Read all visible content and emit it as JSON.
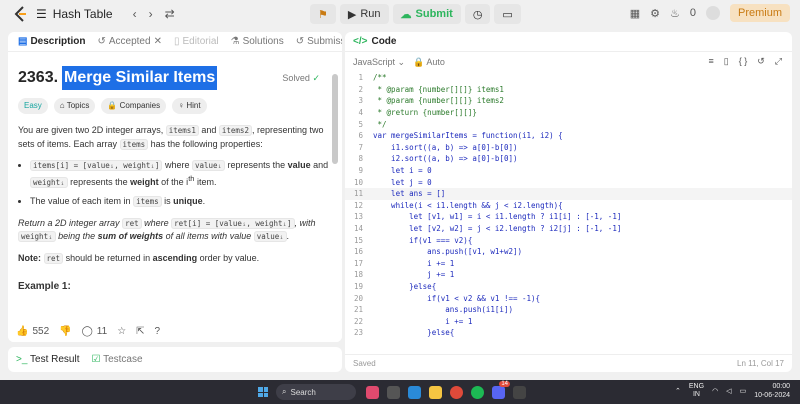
{
  "topbar": {
    "title": "Hash Table",
    "run_label": "Run",
    "submit_label": "Submit",
    "streak": "0",
    "premium_label": "Premium"
  },
  "left_tabs": [
    {
      "label": "Description"
    },
    {
      "label": "Accepted"
    },
    {
      "label": "Editorial"
    },
    {
      "label": "Solutions"
    },
    {
      "label": "Submiss"
    }
  ],
  "problem": {
    "number": "2363.",
    "title": "Merge Similar Items",
    "solved": "Solved",
    "difficulty": "Easy",
    "topics": "Topics",
    "companies": "Companies",
    "hint": "Hint",
    "p1a": "You are given two 2D integer arrays, ",
    "p1_items1": "items1",
    "p1b": " and ",
    "p1_items2": "items2",
    "p1c": ", representing two sets of items. Each array ",
    "p1_items": "items",
    "p1d": " has the following properties:",
    "b1_code": "items[i] = [valueᵢ, weightᵢ]",
    "b1a": " where ",
    "b1_value": "valueᵢ",
    "b1b": " represents the ",
    "b1_value_bold": "value",
    "b1c": " and ",
    "b1_weight": "weightᵢ",
    "b1d": " represents the ",
    "b1_weight_bold": "weight",
    "b1e": " of the i",
    "b1_th": "th",
    "b1f": " item.",
    "b2a": "The value of each item in ",
    "b2_code": "items",
    "b2b": " is ",
    "b2_bold": "unique",
    "b2c": ".",
    "r1": "Return a 2D integer array ",
    "r_code1": "ret",
    "r2": " where ",
    "r_code2": "ret[i] = [valueᵢ, weightᵢ]",
    "r3": ", with ",
    "r_code3": "weightᵢ",
    "r4": " being the ",
    "r_bold": "sum of weights",
    "r5": " of all items with value ",
    "r_code4": "valueᵢ",
    "r6": ".",
    "note_label": "Note:",
    "note_code": "ret",
    "note_a": " should be returned in ",
    "note_bold": "ascending",
    "note_b": " order by value.",
    "example": "Example 1:"
  },
  "actions": {
    "likes": "552",
    "comments": "11"
  },
  "bottom": {
    "test_result": "Test Result",
    "testcase": "Testcase"
  },
  "code_panel": {
    "title": "Code",
    "language": "JavaScript",
    "mode": "Auto",
    "saved": "Saved",
    "position": "Ln 11, Col 17"
  },
  "code_lines": [
    {
      "n": "1",
      "t": "/**"
    },
    {
      "n": "2",
      "t": " * @param {number[][]} items1"
    },
    {
      "n": "3",
      "t": " * @param {number[][]} items2"
    },
    {
      "n": "4",
      "t": " * @return {number[][]}"
    },
    {
      "n": "5",
      "t": " */"
    },
    {
      "n": "6",
      "t": "var mergeSimilarItems = function(i1, i2) {"
    },
    {
      "n": "7",
      "t": "    i1.sort((a, b) => a[0]-b[0])"
    },
    {
      "n": "8",
      "t": "    i2.sort((a, b) => a[0]-b[0])"
    },
    {
      "n": "9",
      "t": "    let i = 0"
    },
    {
      "n": "10",
      "t": "    let j = 0"
    },
    {
      "n": "11",
      "t": "    let ans = []"
    },
    {
      "n": "12",
      "t": "    while(i < i1.length && j < i2.length){"
    },
    {
      "n": "13",
      "t": "        let [v1, w1] = i < i1.length ? i1[i] : [-1, -1]"
    },
    {
      "n": "14",
      "t": "        let [v2, w2] = j < i2.length ? i2[j] : [-1, -1]"
    },
    {
      "n": "15",
      "t": "        if(v1 === v2){"
    },
    {
      "n": "16",
      "t": "            ans.push([v1, w1+w2])"
    },
    {
      "n": "17",
      "t": "            i += 1"
    },
    {
      "n": "18",
      "t": "            j += 1"
    },
    {
      "n": "19",
      "t": "        }else{"
    },
    {
      "n": "20",
      "t": "            if(v1 < v2 && v1 !== -1){"
    },
    {
      "n": "21",
      "t": "                ans.push(i1[i])"
    },
    {
      "n": "22",
      "t": "                i += 1"
    },
    {
      "n": "23",
      "t": "            }else{"
    }
  ],
  "taskbar": {
    "search": "Search",
    "lang": "ENG",
    "region": "IN",
    "time": "00:00",
    "date": "10-06-2024",
    "badge": "14"
  }
}
